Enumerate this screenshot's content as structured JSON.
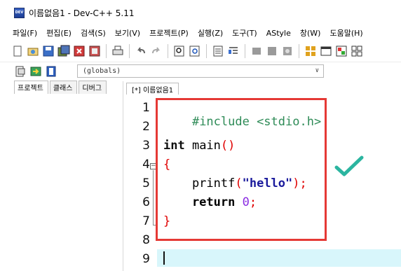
{
  "window": {
    "title": "이름없음1 - Dev-C++ 5.11",
    "app_icon": "devcpp-app-icon"
  },
  "menu": {
    "items": [
      "파일(F)",
      "편집(E)",
      "검색(S)",
      "보기(V)",
      "프로젝트(P)",
      "실행(Z)",
      "도구(T)",
      "AStyle",
      "창(W)",
      "도움말(H)"
    ]
  },
  "toolbar": {
    "icons": [
      "new-file-icon",
      "open-file-icon",
      "save-icon",
      "save-all-icon",
      "close-icon",
      "close-all-icon",
      "print-icon",
      "undo-icon",
      "redo-icon",
      "find-icon",
      "replace-icon",
      "goto-icon",
      "indent-icon",
      "compile-icon",
      "run-icon",
      "compile-run-icon",
      "debug-icon",
      "grid-icon",
      "window-icon",
      "chart-icon",
      "layout-icon"
    ]
  },
  "toolbar2": {
    "scope_value": "(globals)"
  },
  "left_panel": {
    "tabs": [
      "프로젝트",
      "클래스",
      "디버그"
    ],
    "active_tab": 0
  },
  "editor": {
    "tab_label": "[*] 이름없음1",
    "line_numbers": [
      "1",
      "2",
      "3",
      "4",
      "5",
      "6",
      "7",
      "8",
      "9"
    ],
    "lines": {
      "l1": "#include <stdio.h>",
      "l3_kw": "int",
      "l3_name": " main",
      "l3_paren": "()",
      "l4": "{",
      "l5_fn": "    printf",
      "l5_open": "(",
      "l5_str": "\"hello\"",
      "l5_close": ")",
      "l5_semi": ";",
      "l6_kw": "    return ",
      "l6_num": "0",
      "l6_semi": ";",
      "l7": "}"
    },
    "current_line": 9
  },
  "colors": {
    "highlight_box": "#e53935",
    "checkmark": "#2bb5a0",
    "current_line_bg": "#d8f6fb"
  }
}
